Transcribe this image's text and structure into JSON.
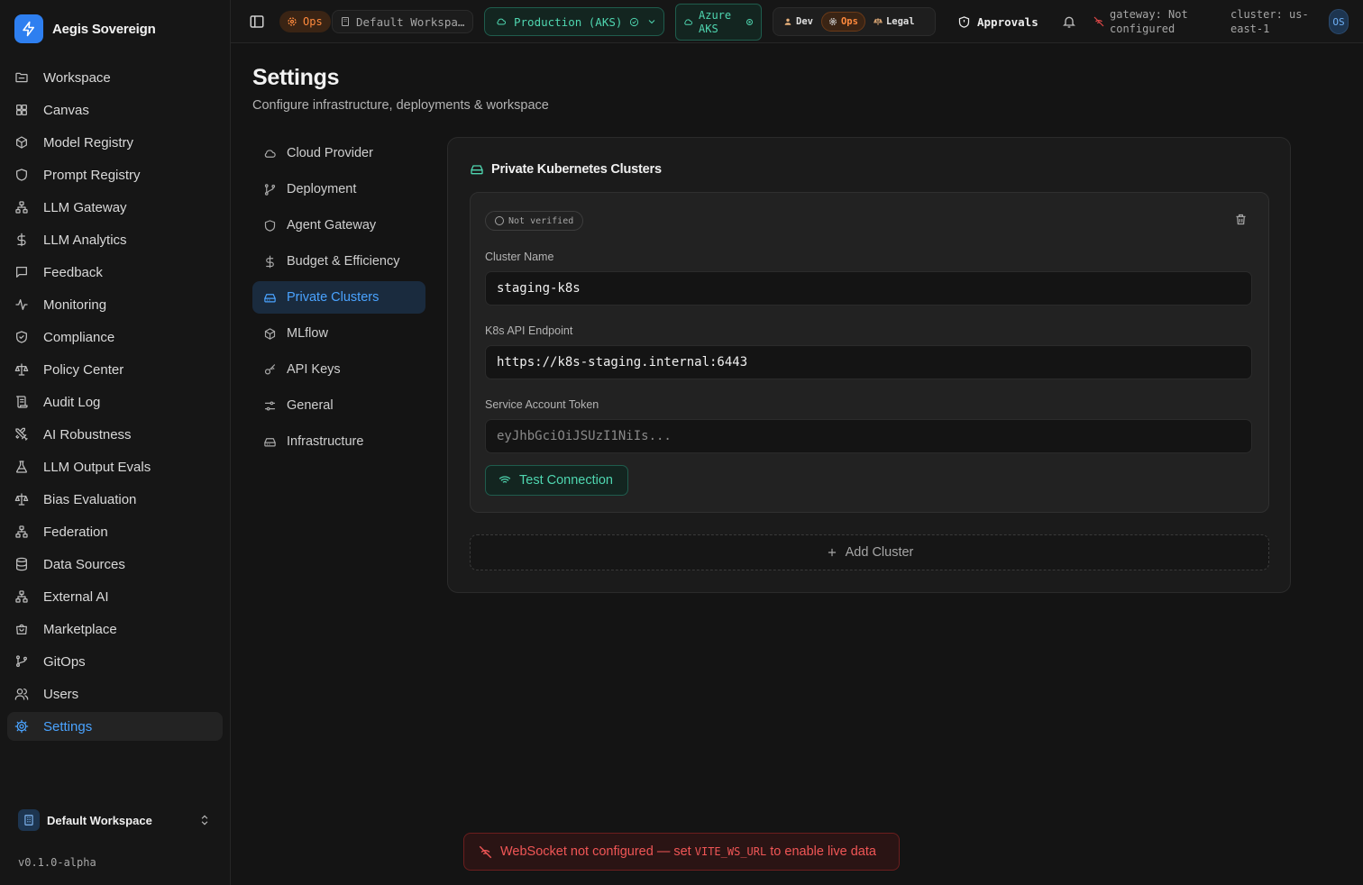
{
  "app": {
    "name": "Aegis Sovereign",
    "version": "v0.1.0-alpha"
  },
  "sidebar": {
    "items": [
      {
        "label": "Workspace",
        "icon": "folder-icon"
      },
      {
        "label": "Canvas",
        "icon": "grid-icon"
      },
      {
        "label": "Model Registry",
        "icon": "cube-icon"
      },
      {
        "label": "Prompt Registry",
        "icon": "shield-icon"
      },
      {
        "label": "LLM Gateway",
        "icon": "network-icon"
      },
      {
        "label": "LLM Analytics",
        "icon": "dollar-icon"
      },
      {
        "label": "Feedback",
        "icon": "message-icon"
      },
      {
        "label": "Monitoring",
        "icon": "activity-icon"
      },
      {
        "label": "Compliance",
        "icon": "shield-check-icon"
      },
      {
        "label": "Policy Center",
        "icon": "scale-icon"
      },
      {
        "label": "Audit Log",
        "icon": "scroll-icon"
      },
      {
        "label": "AI Robustness",
        "icon": "swords-icon"
      },
      {
        "label": "LLM Output Evals",
        "icon": "flask-icon"
      },
      {
        "label": "Bias Evaluation",
        "icon": "scale-icon"
      },
      {
        "label": "Federation",
        "icon": "network-icon"
      },
      {
        "label": "Data Sources",
        "icon": "database-icon"
      },
      {
        "label": "External AI",
        "icon": "network-icon"
      },
      {
        "label": "Marketplace",
        "icon": "store-icon"
      },
      {
        "label": "GitOps",
        "icon": "git-branch-icon"
      },
      {
        "label": "Users",
        "icon": "users-icon"
      },
      {
        "label": "Settings",
        "icon": "gear-icon"
      }
    ],
    "active": "Settings",
    "workspace": "Default Workspace"
  },
  "topbar": {
    "role_chip": "Ops",
    "workspace_chip": "Default Workspa…",
    "environment": "Production (AKS)",
    "cloud_line1": "Azure",
    "cloud_line2": "AKS",
    "roles": [
      "Dev",
      "Ops",
      "Legal"
    ],
    "active_role": "Ops",
    "approvals": "Approvals",
    "gateway_line1": "gateway: Not",
    "gateway_line2": "configured",
    "cluster_line1": "cluster: us-",
    "cluster_line2": "east-1",
    "avatar": "OS"
  },
  "page": {
    "title": "Settings",
    "subtitle": "Configure infrastructure, deployments & workspace"
  },
  "settings_nav": {
    "items": [
      {
        "label": "Cloud Provider",
        "icon": "cloud-icon"
      },
      {
        "label": "Deployment",
        "icon": "git-icon"
      },
      {
        "label": "Agent Gateway",
        "icon": "shield-icon"
      },
      {
        "label": "Budget & Efficiency",
        "icon": "dollar-icon"
      },
      {
        "label": "Private Clusters",
        "icon": "hard-drive-icon"
      },
      {
        "label": "MLflow",
        "icon": "cube-icon"
      },
      {
        "label": "API Keys",
        "icon": "key-icon"
      },
      {
        "label": "General",
        "icon": "sliders-icon"
      },
      {
        "label": "Infrastructure",
        "icon": "hard-drive-icon"
      }
    ],
    "active": "Private Clusters"
  },
  "panel": {
    "title": "Private Kubernetes Clusters",
    "cluster": {
      "status": "Not verified",
      "name_label": "Cluster Name",
      "name_value": "staging-k8s",
      "endpoint_label": "K8s API Endpoint",
      "endpoint_value": "https://k8s-staging.internal:6443",
      "token_label": "Service Account Token",
      "token_placeholder": "eyJhbGciOiJSUzI1NiIs...",
      "test_button": "Test Connection"
    },
    "add_button": "Add Cluster"
  },
  "toast": {
    "prefix": "WebSocket not configured — set ",
    "code": "VITE_WS_URL",
    "suffix": " to enable live data"
  },
  "colors": {
    "accent_blue": "#4aa3ff",
    "accent_teal": "#4fd6b0",
    "ops_orange": "#ff8a3d",
    "error_red": "#f05656"
  }
}
